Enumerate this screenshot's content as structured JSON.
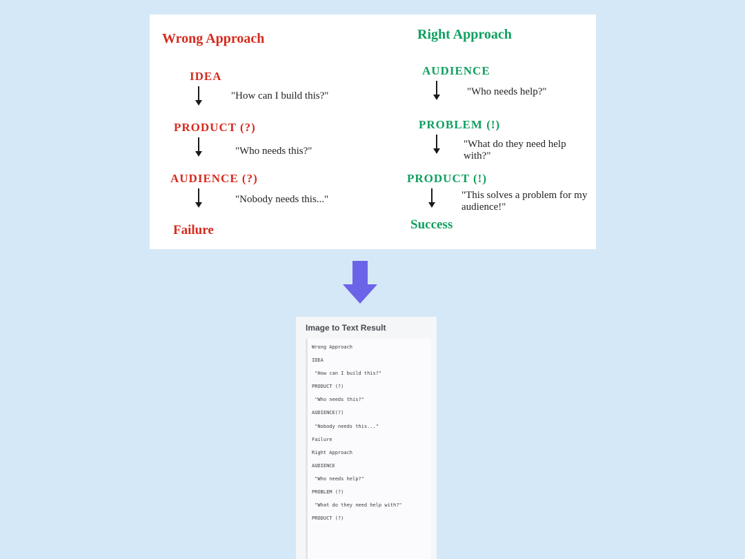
{
  "diagram": {
    "left": {
      "title": "Wrong Approach",
      "steps": [
        {
          "label": "IDEA",
          "quote": "\"How can I build this?\""
        },
        {
          "label": "PRODUCT (?)",
          "quote": "\"Who needs this?\""
        },
        {
          "label": "AUDIENCE (?)",
          "quote": "\"Nobody needs this...\""
        }
      ],
      "outcome": "Failure"
    },
    "right": {
      "title": "Right Approach",
      "steps": [
        {
          "label": "AUDIENCE",
          "quote": "\"Who needs help?\""
        },
        {
          "label": "PROBLEM (!)",
          "quote": "\"What do they need help with?\""
        },
        {
          "label": "PRODUCT (!)",
          "quote": "\"This solves a problem for my audience!\""
        }
      ],
      "outcome": "Success"
    }
  },
  "result": {
    "header": "Image to Text Result",
    "lines": [
      "Wrong Approach",
      "IDEA",
      " \"How can I build this?\"",
      "PRODUCT (?)",
      " \"Who needs this?\"",
      "AUDIENCE(?)",
      " \"Nobody needs this...\"",
      "Failure",
      "Right Approach",
      "AUDIENCE",
      " \"Who needs help?\"",
      "PROBLEM (?)",
      " \"What do they need help with?\"",
      "PRODUCT (?)"
    ]
  }
}
